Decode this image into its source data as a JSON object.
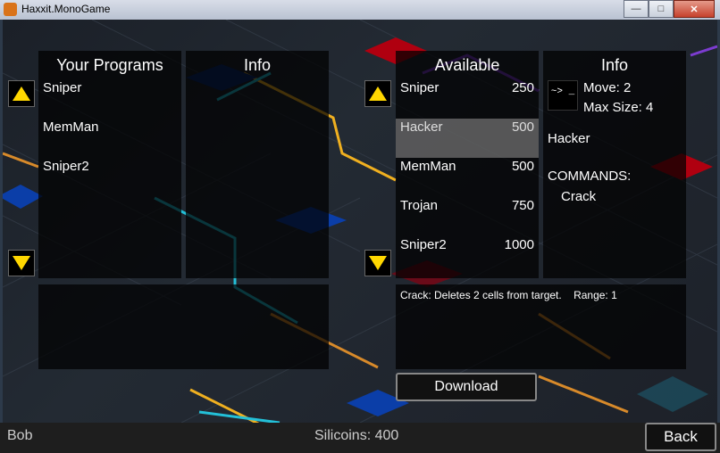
{
  "window": {
    "title": "Haxxit.MonoGame",
    "minimize": "—",
    "maximize": "□",
    "close": "✕"
  },
  "left": {
    "programs_header": "Your Programs",
    "info_header": "Info",
    "programs": [
      "Sniper",
      "MemMan",
      "Sniper2"
    ]
  },
  "right": {
    "available_header": "Available",
    "info_header": "Info",
    "available": [
      {
        "name": "Sniper",
        "price": "250"
      },
      {
        "name": "Hacker",
        "price": "500"
      },
      {
        "name": "MemMan",
        "price": "500"
      },
      {
        "name": "Trojan",
        "price": "750"
      },
      {
        "name": "Sniper2",
        "price": "1000"
      }
    ],
    "selected_index": 1,
    "info": {
      "glyph": "~> _",
      "move": "Move: 2",
      "max_size": "Max Size: 4",
      "name": "Hacker",
      "commands_label": "COMMANDS:",
      "command": "Crack"
    },
    "description": "Crack: Deletes 2 cells from target.    Range: 1"
  },
  "download_label": "Download",
  "footer": {
    "player": "Bob",
    "silicoins": "Silicoins: 400",
    "back_label": "Back"
  },
  "icons": {
    "scroll_up": "triangle-up",
    "scroll_down": "triangle-down"
  },
  "colors": {
    "arrow_yellow": "#ffd700",
    "selection_gray": "#8c8c8c"
  }
}
